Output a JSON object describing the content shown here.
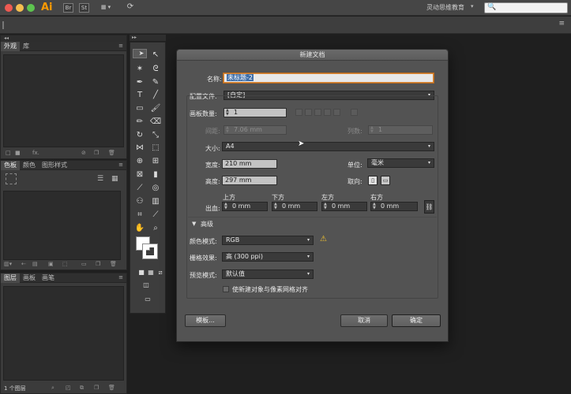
{
  "app": {
    "logo": "Ai",
    "br_label": "Br",
    "st_label": "St",
    "workspace": "灵动思维教育",
    "workspace_caret": "▾"
  },
  "panels": {
    "appearance": {
      "tabs": [
        "外观",
        "库"
      ],
      "footer_fx": "fx."
    },
    "color": {
      "tabs": [
        "色板",
        "颜色",
        "图形样式"
      ]
    },
    "layers": {
      "tabs": [
        "图层",
        "画板",
        "画笔"
      ],
      "footer_count": "1 个图层"
    }
  },
  "dialog": {
    "title": "新建文档",
    "name_label": "名称:",
    "name_value": "未标题-2",
    "profile_label": "配置文件:",
    "profile_value": "[自定]",
    "artboards_label": "画板数量:",
    "artboards_value": "1",
    "spacing_label": "间距:",
    "spacing_value": "7.06 mm",
    "columns_label": "列数:",
    "columns_value": "1",
    "size_label": "大小:",
    "size_value": "A4",
    "width_label": "宽度:",
    "width_value": "210 mm",
    "units_label": "单位:",
    "units_value": "毫米",
    "height_label": "高度:",
    "height_value": "297 mm",
    "orientation_label": "取向:",
    "bleed_label": "出血:",
    "bleed_top_label": "上方",
    "bleed_bottom_label": "下方",
    "bleed_left_label": "左方",
    "bleed_right_label": "右方",
    "bleed_top": "0 mm",
    "bleed_bottom": "0 mm",
    "bleed_left": "0 mm",
    "bleed_right": "0 mm",
    "advanced_label": "高级",
    "color_mode_label": "颜色模式:",
    "color_mode_value": "RGB",
    "raster_label": "栅格效果:",
    "raster_value": "高 (300 ppi)",
    "preview_label": "预览模式:",
    "preview_value": "默认值",
    "align_checkbox_label": "使新建对象与像素网格对齐",
    "templates_button": "模板...",
    "cancel_button": "取消",
    "ok_button": "确定"
  },
  "icons": {
    "search": "🔍",
    "menu": "≡",
    "warning": "⚠",
    "caret": "▾",
    "double_arrow": "◂◂",
    "double_arrow_r": "▸▸"
  }
}
